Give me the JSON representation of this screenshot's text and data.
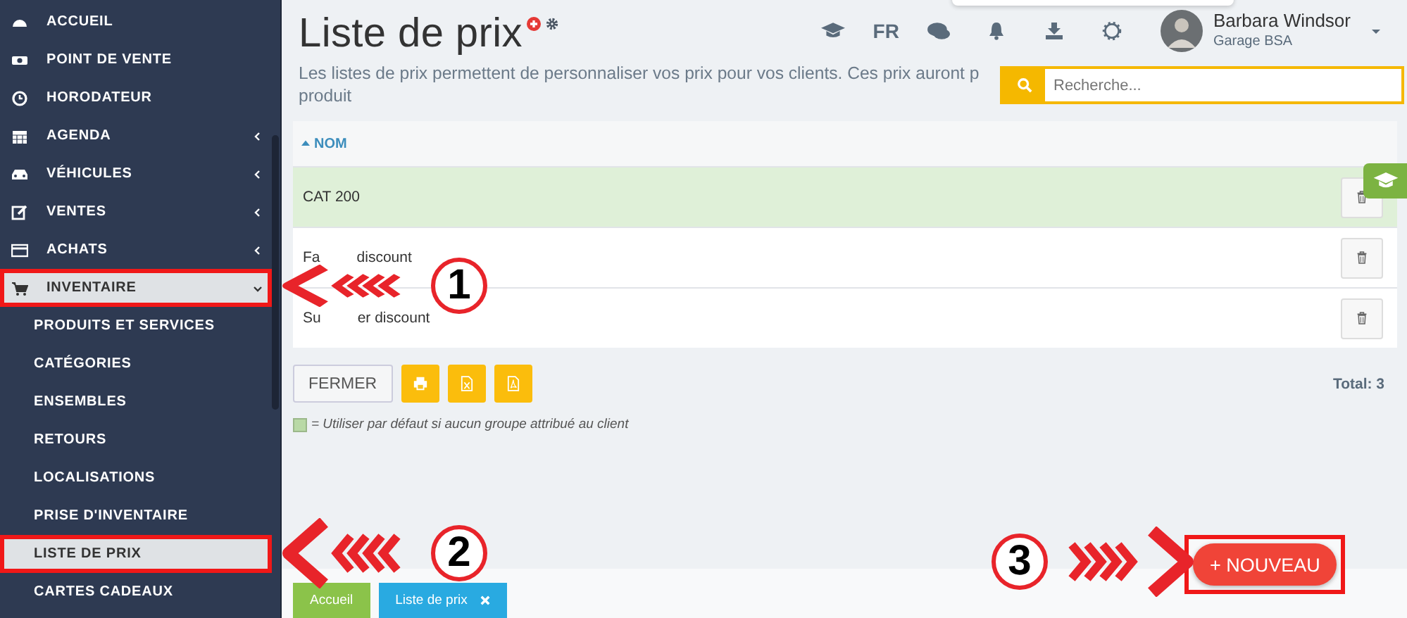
{
  "sidebar": {
    "items": [
      {
        "label": "ACCUEIL",
        "selected": false,
        "highlighted": false
      },
      {
        "label": "POINT DE VENTE",
        "selected": false,
        "highlighted": false
      },
      {
        "label": "HORODATEUR",
        "selected": false,
        "highlighted": false
      },
      {
        "label": "AGENDA",
        "selected": false,
        "highlighted": false,
        "expanded": false
      },
      {
        "label": "VÉHICULES",
        "selected": false,
        "highlighted": false,
        "expanded": false
      },
      {
        "label": "VENTES",
        "selected": false,
        "highlighted": false,
        "expanded": false
      },
      {
        "label": "ACHATS",
        "selected": false,
        "highlighted": false,
        "expanded": false
      },
      {
        "label": "INVENTAIRE",
        "selected": true,
        "highlighted": true,
        "expanded": true,
        "children": [
          {
            "label": "PRODUITS ET SERVICES",
            "selected": false,
            "highlighted": false
          },
          {
            "label": "CATÉGORIES",
            "selected": false,
            "highlighted": false
          },
          {
            "label": "ENSEMBLES",
            "selected": false,
            "highlighted": false
          },
          {
            "label": "RETOURS",
            "selected": false,
            "highlighted": false
          },
          {
            "label": "LOCALISATIONS",
            "selected": false,
            "highlighted": false
          },
          {
            "label": "PRISE D'INVENTAIRE",
            "selected": false,
            "highlighted": false
          },
          {
            "label": "LISTE DE PRIX",
            "selected": true,
            "highlighted": true
          },
          {
            "label": "CARTES CADEAUX",
            "selected": false,
            "highlighted": false
          }
        ]
      }
    ]
  },
  "header": {
    "title": "Liste de prix",
    "description_line_1": "Les listes de prix permettent de personnaliser vos prix pour vos clients. Ces prix auront p",
    "description_line_2": "produit",
    "language": "FR",
    "user": {
      "name": "Barbara Windsor",
      "company": "Garage BSA"
    },
    "search": {
      "placeholder": "Recherche..."
    }
  },
  "table": {
    "columns": [
      {
        "label": "NOM"
      }
    ],
    "rows": [
      {
        "name": "CAT 200",
        "default": true
      },
      {
        "name": "Fa",
        "name_after_overlay": "discount",
        "default": false
      },
      {
        "name": "Su",
        "name_after_overlay": "er discount",
        "default": false
      }
    ]
  },
  "actions": {
    "close": "FERMER",
    "total": "Total: 3"
  },
  "legend": "= Utiliser par défaut si aucun groupe attribué au client",
  "new_button": "+ NOUVEAU",
  "bottom_tabs": [
    {
      "label": "Accueil",
      "selected": false,
      "closable": false
    },
    {
      "label": "Liste de prix",
      "selected": true,
      "closable": true
    }
  ],
  "annotations": [
    {
      "number": "1"
    },
    {
      "number": "2"
    },
    {
      "number": "3"
    }
  ]
}
